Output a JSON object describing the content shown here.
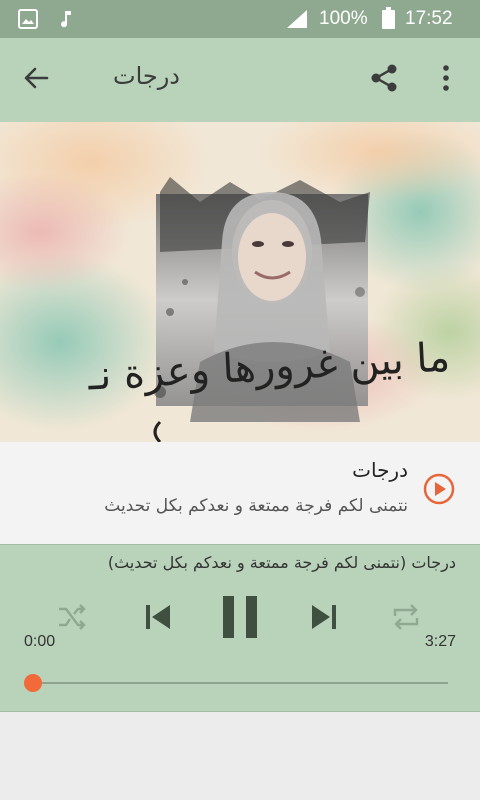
{
  "status_bar": {
    "battery_percent": "100%",
    "time": "17:52",
    "icons": [
      "image-notification-icon",
      "music-notification-icon",
      "signal-icon",
      "battery-icon"
    ]
  },
  "app_bar": {
    "title": "درجات",
    "icons": [
      "back-arrow-icon",
      "share-icon",
      "more-vert-icon"
    ]
  },
  "artwork": {
    "caption": "ما بين غرورها وعزة نـ"
  },
  "track": {
    "title": "درجات",
    "subtitle": "نتمنى لكم فرجة ممتعة و نعدكم بكل تحديث",
    "accent_color": "#e8643a"
  },
  "player": {
    "now_playing": "درجات (نتمنى لكم فرجة ممتعة و نعدكم بكل تحديث)",
    "elapsed": "0:00",
    "duration": "3:27",
    "progress": 0.0,
    "icons": [
      "shuffle-icon",
      "previous-icon",
      "pause-icon",
      "next-icon",
      "repeat-icon"
    ],
    "thumb_color": "#f26a3a"
  }
}
